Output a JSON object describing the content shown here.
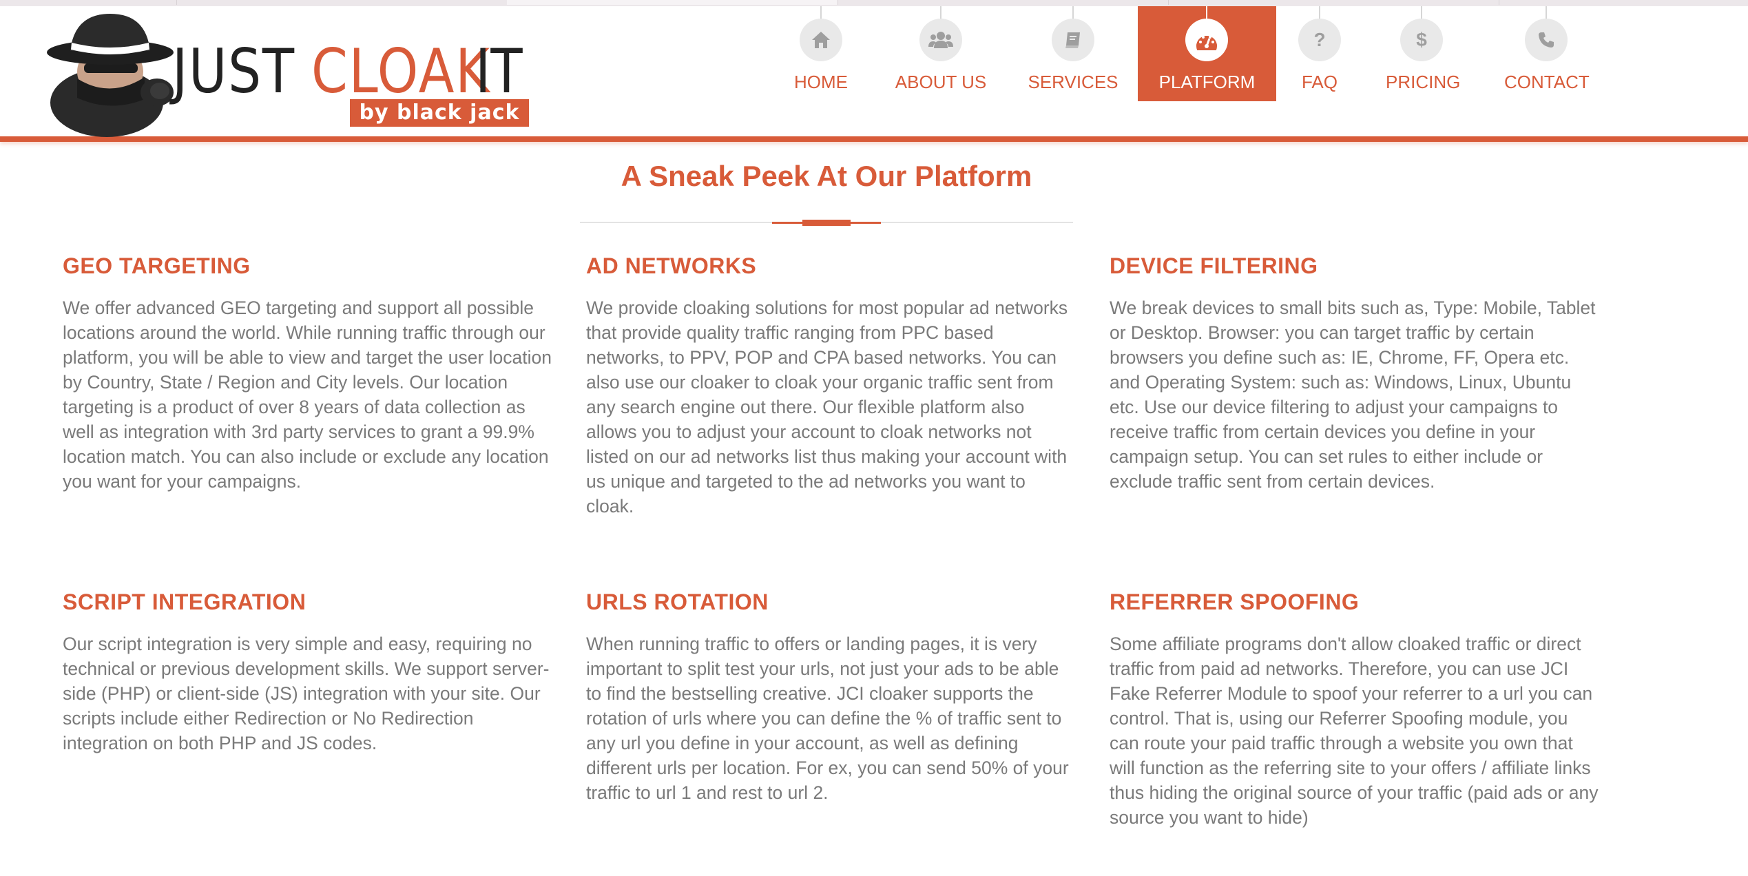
{
  "logo": {
    "name_part1": "JUST",
    "name_part2": "CLOAK",
    "name_part3": "IT",
    "byline": "by black jack"
  },
  "colors": {
    "accent": "#d85b39",
    "body_text": "#7a7a7a",
    "icon_grey": "#9e9e9e"
  },
  "nav": [
    {
      "label": "HOME",
      "icon": "home-icon",
      "active": false
    },
    {
      "label": "ABOUT US",
      "icon": "users-icon",
      "active": false
    },
    {
      "label": "SERVICES",
      "icon": "book-icon",
      "active": false
    },
    {
      "label": "PLATFORM",
      "icon": "dashboard-icon",
      "active": true
    },
    {
      "label": "FAQ",
      "icon": "question-icon",
      "active": false
    },
    {
      "label": "PRICING",
      "icon": "dollar-icon",
      "active": false
    },
    {
      "label": "CONTACT",
      "icon": "phone-icon",
      "active": false
    }
  ],
  "section": {
    "title": "A Sneak Peek At Our Platform"
  },
  "features": [
    {
      "title": "GEO TARGETING",
      "text": "We offer advanced GEO targeting and support all possible locations around the world. While running traffic through our platform, you will be able to view and target the user location by Country, State / Region and City levels. Our location targeting is a product of over 8 years of data collection as well as integration with 3rd party services to grant a 99.9% location match. You can also include or exclude any location you want for your campaigns."
    },
    {
      "title": "AD NETWORKS",
      "text": "We provide cloaking solutions for most popular ad networks that provide quality traffic ranging from PPC based networks, to PPV, POP and CPA based networks. You can also use our cloaker to cloak your organic traffic sent from any search engine out there. Our flexible platform also allows you to adjust your account to cloak networks not listed on our ad networks list thus making your account with us unique and targeted to the ad networks you want to cloak."
    },
    {
      "title": "DEVICE FILTERING",
      "text": "We break devices to small bits such as, Type: Mobile, Tablet or Desktop. Browser: you can target traffic by certain browsers you define such as: IE, Chrome, FF, Opera etc. and Operating System: such as: Windows, Linux, Ubuntu etc. Use our device filtering to adjust your campaigns to receive traffic from certain devices you define in your campaign setup. You can set rules to either include or exclude traffic sent from certain devices."
    },
    {
      "title": "SCRIPT INTEGRATION",
      "text": "Our script integration is very simple and easy, requiring no technical or previous development skills. We support server-side (PHP) or client-side (JS) integration with your site. Our scripts include either Redirection or No Redirection integration on both PHP and JS codes."
    },
    {
      "title": "URLS ROTATION",
      "text": "When running traffic to offers or landing pages, it is very important to split test your urls, not just your ads to be able to find the bestselling creative. JCI cloaker supports the rotation of urls where you can define the % of traffic sent to any url you define in your account, as well as defining different urls per location. For ex, you can send 50% of your traffic to url 1 and rest to url 2."
    },
    {
      "title": "REFERRER SPOOFING",
      "text": "Some affiliate programs don't allow cloaked traffic or direct traffic from paid ad networks. Therefore, you can use JCI Fake Referrer Module to spoof your referrer to a url you can control. That is, using our Referrer Spoofing module, you can route your paid traffic through a website you own that will function as the referring site to your offers / affiliate links thus hiding the original source of your traffic (paid ads or any source you want to hide)"
    }
  ]
}
